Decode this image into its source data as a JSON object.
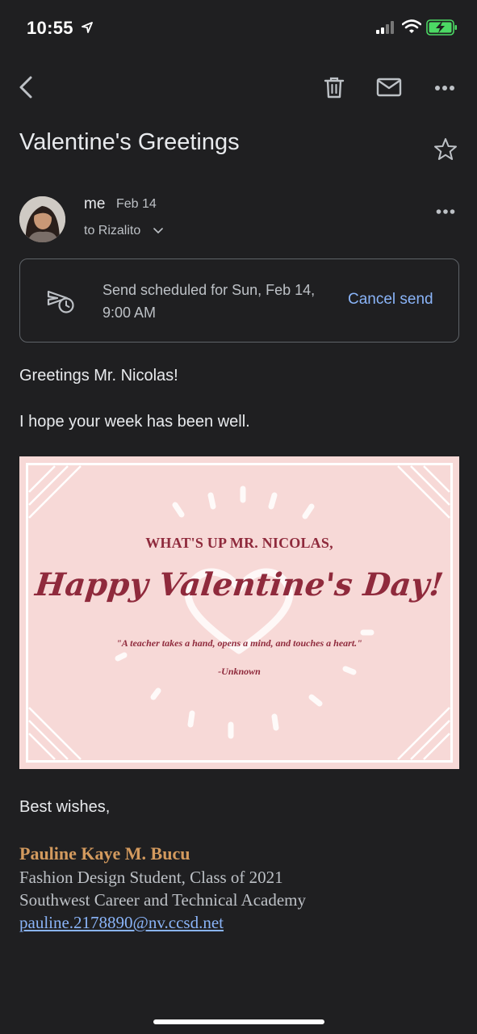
{
  "status_bar": {
    "time": "10:55"
  },
  "toolbar": {
    "icons": [
      "back-arrow-icon",
      "trash-icon",
      "mail-icon",
      "more-icon"
    ]
  },
  "email": {
    "subject": "Valentine's Greetings",
    "sender": "me",
    "date": "Feb 14",
    "recipient": "to Rizalito",
    "schedule": {
      "text": "Send scheduled for Sun, Feb 14, 9:00 AM",
      "cancel_label": "Cancel send"
    },
    "body": {
      "greeting": "Greetings Mr. Nicolas!",
      "line2": "I hope your week has been well.",
      "closing": "Best wishes,"
    },
    "card": {
      "heading": "WHAT'S UP MR. NICOLAS,",
      "title": "Happy Valentine's Day!",
      "quote": "\"A teacher takes a hand, opens a mind, and touches a heart.\"",
      "author": "-Unknown",
      "colors": {
        "background": "#f7d9d7",
        "text": "#8f2a3c"
      }
    },
    "signature": {
      "name": "Pauline Kaye M. Bucu",
      "line1": "Fashion Design Student, Class of 2021",
      "line2": "Southwest Career and Technical Academy",
      "email": "pauline.2178890@nv.ccsd.net"
    }
  },
  "colors": {
    "background": "#1f1f21",
    "accent": "#8ab4f8",
    "signature_name": "#d39a5e"
  }
}
